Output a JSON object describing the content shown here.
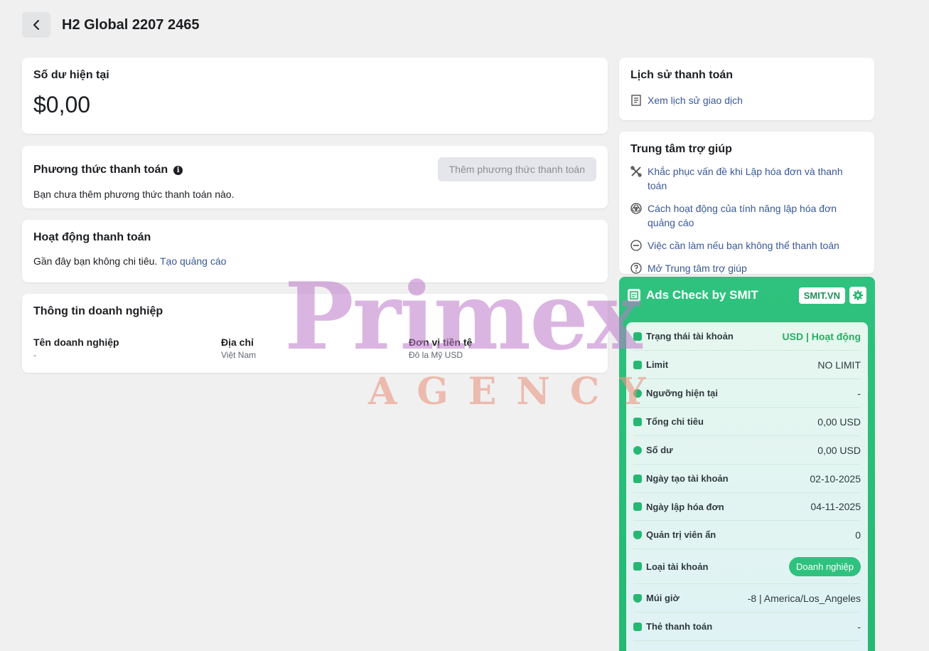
{
  "header": {
    "title": "H2 Global 2207 2465"
  },
  "balance": {
    "title": "Số dư hiện tại",
    "amount": "$0,00"
  },
  "payment_method": {
    "title": "Phương thức thanh toán",
    "add_button": "Thêm phương thức thanh toán",
    "empty_text": "Bạn chưa thêm phương thức thanh toán nào."
  },
  "activity": {
    "title": "Hoạt động thanh toán",
    "text": "Gần đây bạn không chi tiêu.",
    "link": "Tạo quảng cáo"
  },
  "business": {
    "title": "Thông tin doanh nghiệp",
    "columns": [
      {
        "label": "Tên doanh nghiệp",
        "value": "-"
      },
      {
        "label": "Địa chỉ",
        "value": "Việt Nam"
      },
      {
        "label": "Đơn vị tiền tệ",
        "value": "Đô la Mỹ USD"
      }
    ]
  },
  "history": {
    "title": "Lịch sử thanh toán",
    "link": "Xem lịch sử giao dịch"
  },
  "help": {
    "title": "Trung tâm trợ giúp",
    "links": [
      "Khắc phục vấn đề khi Lập hóa đơn và thanh toán",
      "Cách hoạt động của tính năng lập hóa đơn quảng cáo",
      "Việc cần làm nếu bạn không thể thanh toán",
      "Mở Trung tâm trợ giúp"
    ]
  },
  "smit": {
    "title": "Ads Check by SMIT",
    "site_button": "SMIT.VN",
    "rows": [
      {
        "label": "Trạng thái tài khoản",
        "value": "USD | Hoạt động"
      },
      {
        "label": "Limit",
        "value": "NO LIMIT"
      },
      {
        "label": "Ngưỡng hiện tại",
        "value": "-"
      },
      {
        "label": "Tổng chi tiêu",
        "value": "0,00 USD"
      },
      {
        "label": "Số dư",
        "value": "0,00 USD"
      },
      {
        "label": "Ngày tạo tài khoản",
        "value": "02-10-2025"
      },
      {
        "label": "Ngày lập hóa đơn",
        "value": "04-11-2025"
      },
      {
        "label": "Quản trị viên ẩn",
        "value": "0"
      },
      {
        "label": "Loại tài khoản",
        "value": "Doanh nghiệp"
      },
      {
        "label": "Múi giờ",
        "value": "-8 | America/Los_Angeles"
      },
      {
        "label": "Thẻ thanh toán",
        "value": "-"
      }
    ]
  },
  "watermark": {
    "brand": "Primex",
    "sub": "AGENCY"
  }
}
